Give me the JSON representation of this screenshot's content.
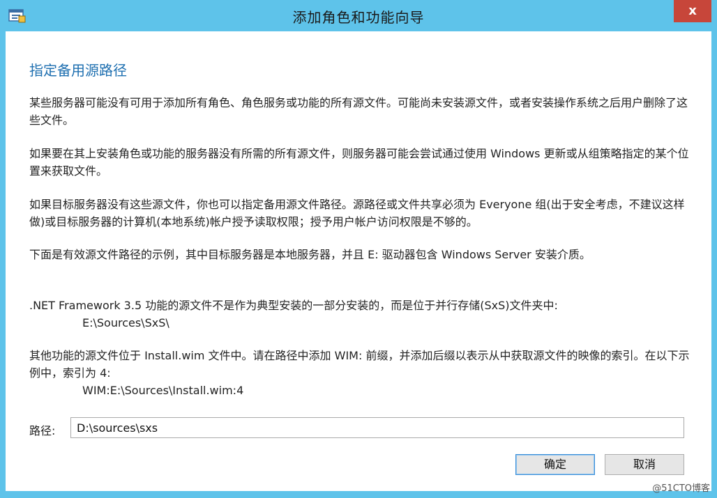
{
  "window": {
    "title": "添加角色和功能向导",
    "close_glyph": "x"
  },
  "heading": "指定备用源路径",
  "paragraphs": [
    "某些服务器可能没有可用于添加所有角色、角色服务或功能的所有源文件。可能尚未安装源文件，或者安装操作系统之后用户删除了这些文件。",
    "如果要在其上安装角色或功能的服务器没有所需的所有源文件，则服务器可能会尝试通过使用 Windows 更新或从组策略指定的某个位置来获取文件。",
    "如果目标服务器没有这些源文件，你也可以指定备用源文件路径。源路径或文件共享必须为 Everyone 组(出于安全考虑，不建议这样做)或目标服务器的计算机(本地系统)帐户授予读取权限；授予用户帐户访问权限是不够的。",
    "下面是有效源文件路径的示例，其中目标服务器是本地服务器，并且 E: 驱动器包含 Windows Server 安装介质。"
  ],
  "netfx": {
    "text": ".NET Framework 3.5 功能的源文件不是作为典型安装的一部分安装的，而是位于并行存储(SxS)文件夹中:",
    "example": "E:\\Sources\\SxS\\"
  },
  "wim": {
    "text": "其他功能的源文件位于 Install.wim 文件中。请在路径中添加 WIM: 前缀，并添加后缀以表示从中获取源文件的映像的索引。在以下示例中，索引为 4:",
    "example": "WIM:E:\\Sources\\Install.wim:4"
  },
  "path": {
    "label": "路径:",
    "value": "D:\\sources\\sxs"
  },
  "buttons": {
    "ok": "确定",
    "cancel": "取消"
  },
  "watermark": "@51CTO博客",
  "icons": {
    "app": "server-manager-icon",
    "close": "close-icon"
  },
  "colors": {
    "titlebar": "#5ec3ea",
    "close_button": "#c7463a",
    "heading": "#1e6fb0"
  }
}
